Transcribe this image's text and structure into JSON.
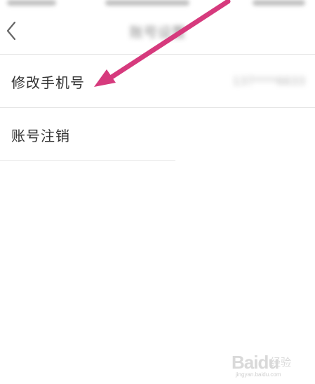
{
  "header": {
    "title": "账号设置"
  },
  "rows": [
    {
      "label": "修改手机号",
      "value": "137****6633"
    },
    {
      "label": "账号注销"
    }
  ],
  "watermark": {
    "brand": "Baidu",
    "cn": "经验",
    "url": "jingyan.baidu.com"
  },
  "colors": {
    "arrow": "#d63a7d",
    "divider": "#e6e6e6",
    "text": "#333333"
  },
  "icons": {
    "back": "chevron-left-icon"
  }
}
